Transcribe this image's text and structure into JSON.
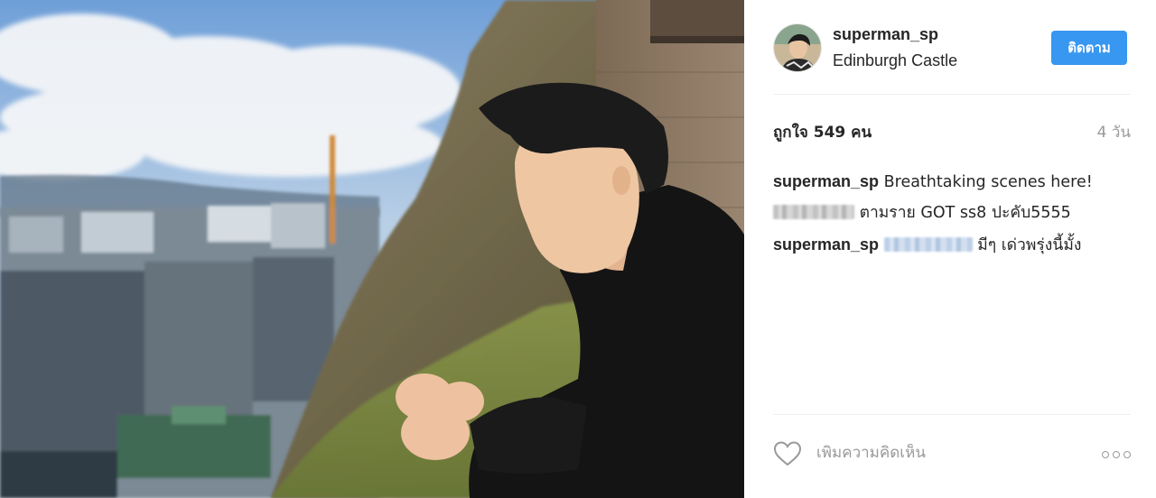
{
  "post": {
    "author": {
      "username": "superman_sp",
      "location": "Edinburgh Castle"
    },
    "follow_label": "ติดตาม",
    "likes_text": "ถูกใจ 549 คน",
    "time_text": "4 วัน",
    "comments": [
      {
        "user": "superman_sp",
        "text": "Breathtaking scenes here!"
      },
      {
        "user": "",
        "text": "ตามราย GOT ss8 ปะคับ5555"
      },
      {
        "user": "superman_sp",
        "text": "มีๆ เด่วพรุ่งนี้มั้ง"
      }
    ],
    "add_comment_placeholder": "เพิ่มความคิดเห็น"
  },
  "icons": {
    "like": "heart-icon",
    "more": "more-options-icon"
  },
  "colors": {
    "follow_button": "#3897f0",
    "muted_text": "#999999",
    "divider": "#efefef"
  }
}
